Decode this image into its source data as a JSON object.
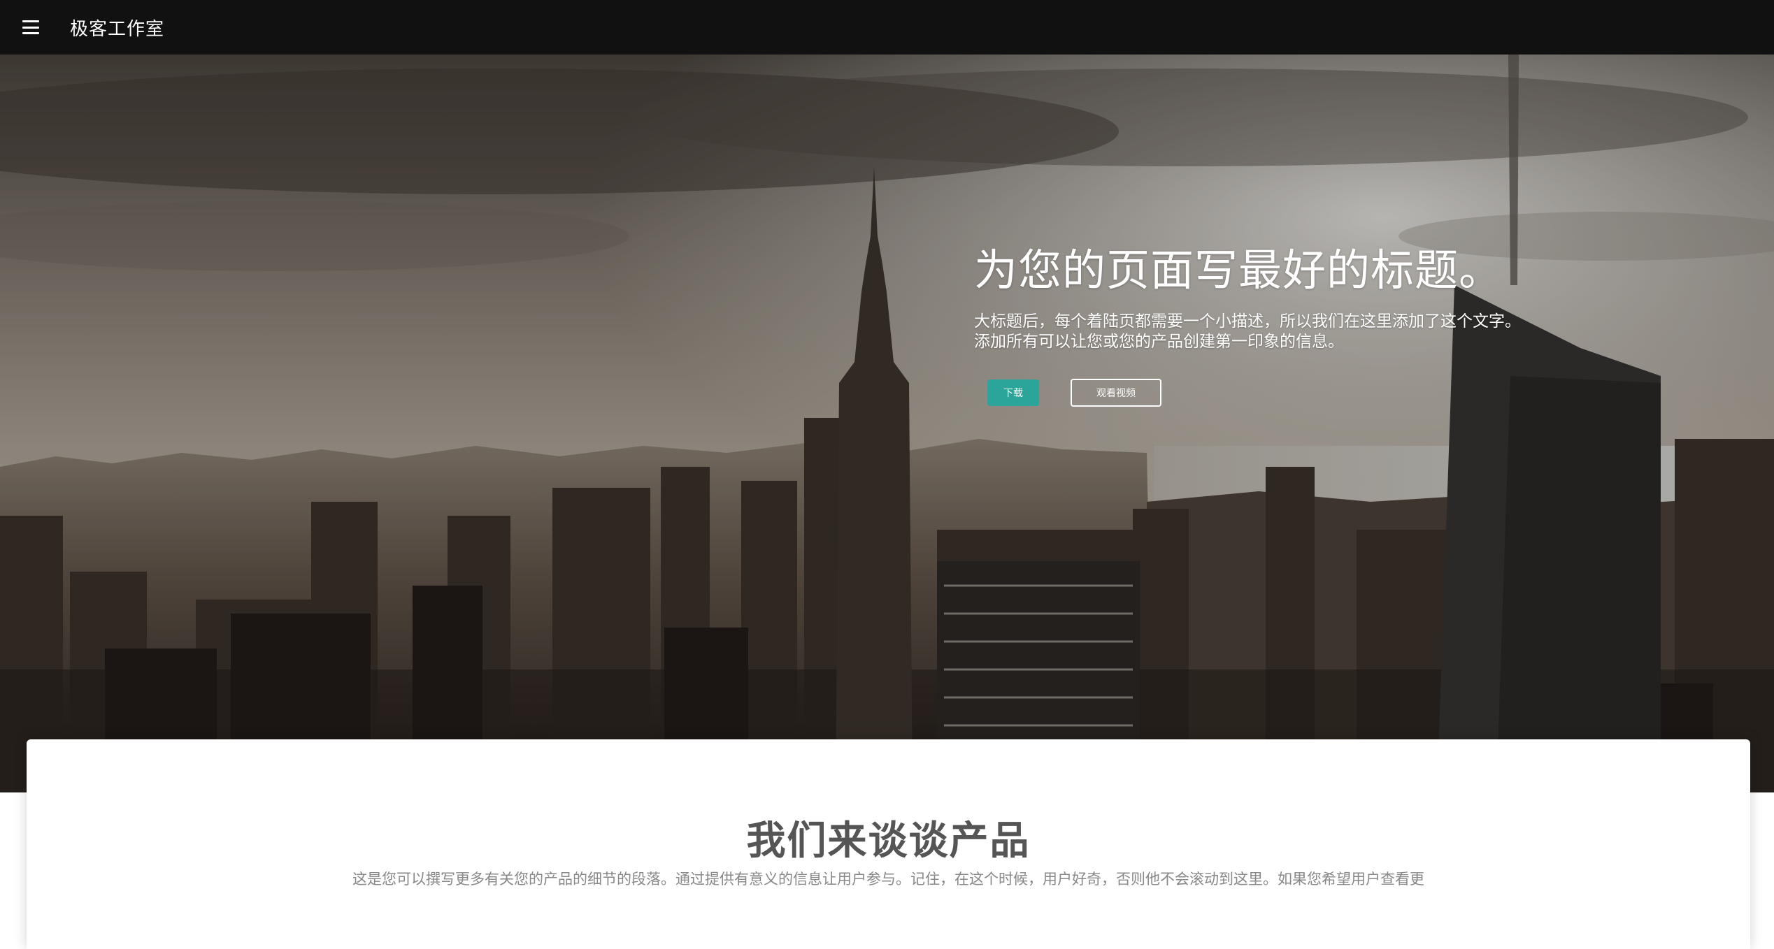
{
  "navbar": {
    "menu_icon": "hamburger-menu-icon",
    "brand": "极客工作室"
  },
  "hero": {
    "title": "为您的页面写最好的标题。",
    "description_line1": "大标题后，每个着陆页都需要一个小描述，所以我们在这里添加了这个文字。",
    "description_line2": "添加所有可以让您或您的产品创建第一印象的信息。",
    "download_label": "下载",
    "watch_video_label": "观看视频"
  },
  "product_section": {
    "title": "我们来谈谈产品",
    "text": "这是您可以撰写更多有关您的产品的细节的段落。通过提供有意义的信息让用户参与。记住，在这个时候，用户好奇，否则他不会滚动到这里。如果您希望用户查看更"
  },
  "colors": {
    "navbar_bg": "#111111",
    "accent": "#2ba59a",
    "title_text": "#555555",
    "body_text": "#888888"
  }
}
